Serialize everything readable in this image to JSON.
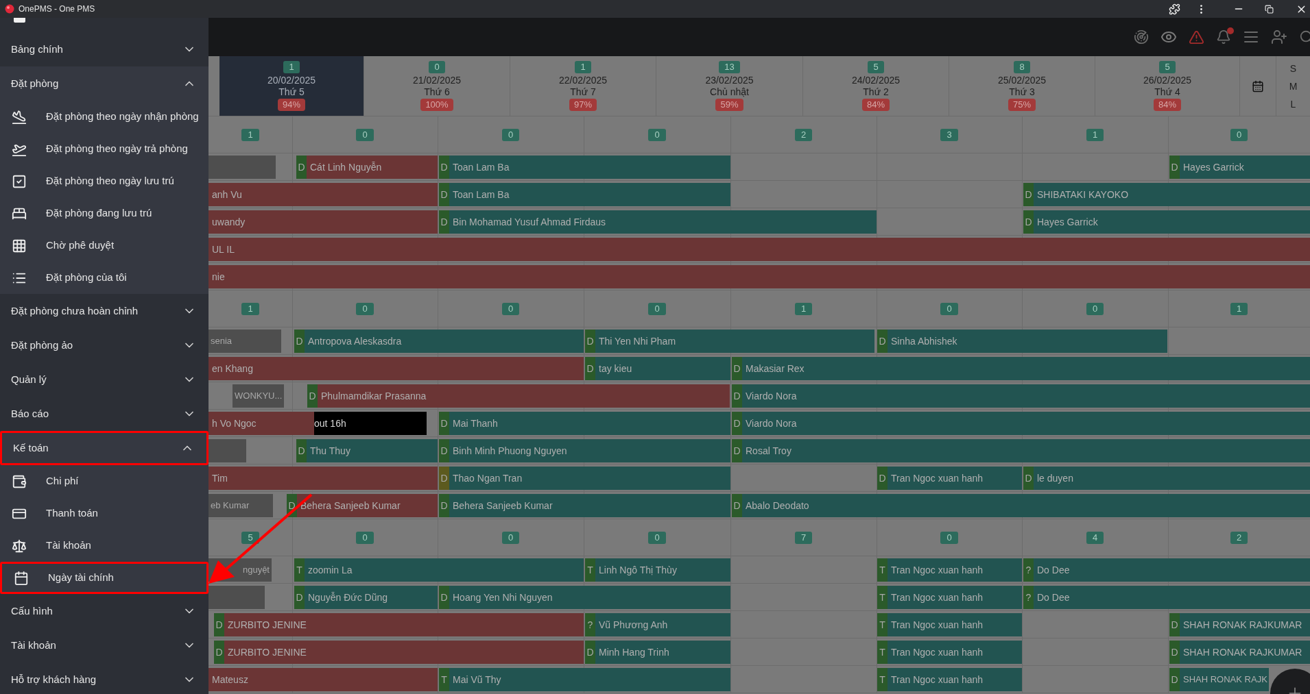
{
  "window": {
    "title": "OnePMS - One PMS"
  },
  "sidebar": {
    "sections": [
      {
        "label": "Bảng chính",
        "expanded": false,
        "highlighted": false
      },
      {
        "label": "Đặt phòng",
        "expanded": true,
        "highlighted": false,
        "children": [
          {
            "label": "Đặt phòng theo ngày nhận phòng",
            "highlighted": false
          },
          {
            "label": "Đặt phòng theo ngày trả phòng",
            "highlighted": false
          },
          {
            "label": "Đặt phòng theo ngày lưu trú",
            "highlighted": false
          },
          {
            "label": "Đặt phòng đang lưu trú",
            "highlighted": false
          },
          {
            "label": "Chờ phê duyệt",
            "highlighted": false
          },
          {
            "label": "Đặt phòng của tôi",
            "highlighted": false
          }
        ]
      },
      {
        "label": "Đặt phòng chưa hoàn chỉnh",
        "expanded": false,
        "highlighted": false
      },
      {
        "label": "Đặt phòng ảo",
        "expanded": false,
        "highlighted": false
      },
      {
        "label": "Quản lý",
        "expanded": false,
        "highlighted": false
      },
      {
        "label": "Báo cáo",
        "expanded": false,
        "highlighted": false
      },
      {
        "label": "Kế toán",
        "expanded": true,
        "highlighted": true,
        "children": [
          {
            "label": "Chi phí",
            "highlighted": false
          },
          {
            "label": "Thanh toán",
            "highlighted": false
          },
          {
            "label": "Tài khoản",
            "highlighted": false
          },
          {
            "label": "Ngày tài chính",
            "highlighted": true
          }
        ]
      },
      {
        "label": "Cấu hình",
        "expanded": false,
        "highlighted": false
      },
      {
        "label": "Tài khoản",
        "expanded": false,
        "highlighted": false
      },
      {
        "label": "Hỗ trợ khách hàng",
        "expanded": false,
        "highlighted": false
      }
    ]
  },
  "calendar": {
    "days": [
      {
        "count": "1",
        "date": "20/02/2025",
        "weekday": "Thứ 5",
        "occupancy": "94%",
        "selected": true
      },
      {
        "count": "0",
        "date": "21/02/2025",
        "weekday": "Thứ 6",
        "occupancy": "100%",
        "selected": false
      },
      {
        "count": "1",
        "date": "22/02/2025",
        "weekday": "Thứ 7",
        "occupancy": "97%",
        "selected": false
      },
      {
        "count": "13",
        "date": "23/02/2025",
        "weekday": "Chủ nhật",
        "occupancy": "59%",
        "selected": false
      },
      {
        "count": "5",
        "date": "24/02/2025",
        "weekday": "Thứ 2",
        "occupancy": "84%",
        "selected": false
      },
      {
        "count": "8",
        "date": "25/02/2025",
        "weekday": "Thứ 3",
        "occupancy": "75%",
        "selected": false
      },
      {
        "count": "5",
        "date": "26/02/2025",
        "weekday": "Thứ 4",
        "occupancy": "84%",
        "selected": false
      }
    ],
    "sizes": [
      "S",
      "M",
      "L"
    ],
    "groups": [
      {
        "counts": [
          "1",
          "0",
          "0",
          "0",
          "2",
          "3",
          "1",
          "0"
        ],
        "rows": [
          {
            "bars": [
              {
                "kind": "block"
              },
              {
                "kind": "booking",
                "tag": {
                  "label": "D",
                  "color": "#2b5a2a"
                },
                "name": "Cát Linh Nguyễn",
                "color": "#6b3535"
              },
              {
                "kind": "booking",
                "tag": {
                  "label": "D",
                  "color": "#2b5a2a"
                },
                "name": "Toan Lam Ba",
                "color": "#225451"
              },
              {
                "kind": "booking",
                "tag": {
                  "label": "D",
                  "color": "#2b5a2a"
                },
                "name": "Hayes Garrick",
                "color": "#225451"
              }
            ]
          },
          {
            "bars": [
              {
                "kind": "booking",
                "name": "anh Vu",
                "color": "#6b3535"
              },
              {
                "kind": "booking",
                "tag": {
                  "label": "D",
                  "color": "#2b5a2a"
                },
                "name": "Toan Lam Ba",
                "color": "#225451"
              },
              {
                "kind": "booking",
                "tag": {
                  "label": "D",
                  "color": "#2b5a2a"
                },
                "name": "SHIBATAKI KAYOKO",
                "color": "#225451"
              }
            ]
          },
          {
            "bars": [
              {
                "kind": "booking",
                "name": "uwandy",
                "color": "#6b3535"
              },
              {
                "kind": "booking",
                "tag": {
                  "label": "D",
                  "color": "#2b5a2a"
                },
                "name": "Bin Mohamad Yusuf Ahmad Firdaus",
                "color": "#225451"
              },
              {
                "kind": "booking",
                "tag": {
                  "label": "D",
                  "color": "#2b5a2a"
                },
                "name": "Hayes Garrick",
                "color": "#225451"
              }
            ]
          },
          {
            "bars": [
              {
                "kind": "booking",
                "name": "UL IL",
                "color": "#6b3535"
              }
            ]
          },
          {
            "bars": [
              {
                "kind": "booking",
                "name": "nie",
                "color": "#6b3535"
              }
            ]
          }
        ]
      },
      {
        "counts": [
          "1",
          "0",
          "0",
          "0",
          "1",
          "0",
          "0",
          "1"
        ],
        "rows": [
          {
            "bars": [
              {
                "kind": "block",
                "name": "senia"
              },
              {
                "kind": "booking",
                "tag": {
                  "label": "D",
                  "color": "#2b5a2a"
                },
                "name": "Antropova Aleskasdra",
                "color": "#225451"
              },
              {
                "kind": "booking",
                "tag": {
                  "label": "D",
                  "color": "#2b5a2a"
                },
                "name": "Thi Yen Nhi Pham",
                "color": "#225451"
              },
              {
                "kind": "booking",
                "tag": {
                  "label": "D",
                  "color": "#2b5a2a"
                },
                "name": "Sinha Abhishek",
                "color": "#225451"
              }
            ]
          },
          {
            "bars": [
              {
                "kind": "booking",
                "name": "en Khang",
                "color": "#6b3535"
              },
              {
                "kind": "booking",
                "tag": {
                  "label": "D",
                  "color": "#2b5a2a"
                },
                "name": "tay kieu",
                "color": "#225451"
              },
              {
                "kind": "booking",
                "tag": {
                  "label": "D",
                  "color": "#2b5a2a"
                },
                "name": "Makasiar Rex",
                "color": "#225451"
              }
            ]
          },
          {
            "bars": [
              {
                "kind": "block",
                "name": "WONKYU..."
              },
              {
                "kind": "booking",
                "tag": {
                  "label": "D",
                  "color": "#2b5a2a"
                },
                "name": "Phulmamdikar Prasanna",
                "color": "#6b3535"
              },
              {
                "kind": "booking",
                "tag": {
                  "label": "D",
                  "color": "#2b5a2a"
                },
                "name": "Viardo Nora",
                "color": "#225451"
              }
            ]
          },
          {
            "bars": [
              {
                "kind": "booking",
                "name": "h Vo Ngoc",
                "color": "#6b3535"
              },
              {
                "kind": "note",
                "name": "out 16h"
              },
              {
                "kind": "booking",
                "tag": {
                  "label": "D",
                  "color": "#2b5a2a"
                },
                "name": "Mai Thanh",
                "color": "#225451"
              },
              {
                "kind": "booking",
                "tag": {
                  "label": "D",
                  "color": "#2b5a2a"
                },
                "name": "Viardo Nora",
                "color": "#225451"
              }
            ]
          },
          {
            "bars": [
              {
                "kind": "block"
              },
              {
                "kind": "booking",
                "tag": {
                  "label": "D",
                  "color": "#2b5a2a"
                },
                "name": "Thu Thuy",
                "color": "#225451"
              },
              {
                "kind": "booking",
                "tag": {
                  "label": "D",
                  "color": "#2b5a2a"
                },
                "name": "Binh Minh Phuong Nguyen",
                "color": "#225451"
              },
              {
                "kind": "booking",
                "tag": {
                  "label": "D",
                  "color": "#2b5a2a"
                },
                "name": "Rosal Troy",
                "color": "#225451"
              }
            ]
          },
          {
            "bars": [
              {
                "kind": "booking",
                "name": "Tim",
                "color": "#6b3535"
              },
              {
                "kind": "booking",
                "tag": {
                  "label": "D",
                  "color": "#5c5a1e"
                },
                "name": "Thao Ngan Tran",
                "color": "#225451"
              },
              {
                "kind": "booking",
                "tag": {
                  "label": "D",
                  "color": "#2b5a2a"
                },
                "name": "Tran Ngoc xuan hanh",
                "color": "#225451"
              },
              {
                "kind": "booking",
                "tag": {
                  "label": "D",
                  "color": "#2b5a2a"
                },
                "name": "le duyen",
                "color": "#225451"
              }
            ]
          },
          {
            "bars": [
              {
                "kind": "block",
                "name": "eb Kumar"
              },
              {
                "kind": "booking",
                "tag": {
                  "label": "D",
                  "color": "#2b5a2a"
                },
                "name": "Behera Sanjeeb Kumar",
                "color": "#6b3535"
              },
              {
                "kind": "booking",
                "tag": {
                  "label": "D",
                  "color": "#2b5a2a"
                },
                "name": "Behera Sanjeeb Kumar",
                "color": "#225451"
              },
              {
                "kind": "booking",
                "tag": {
                  "label": "D",
                  "color": "#2b5a2a"
                },
                "name": "Abalo Deodato",
                "color": "#225451"
              }
            ]
          }
        ]
      },
      {
        "counts": [
          "5",
          "0",
          "0",
          "0",
          "7",
          "0",
          "4",
          "2"
        ],
        "rows": [
          {
            "bars": [
              {
                "kind": "block",
                "name": "nguyệt"
              },
              {
                "kind": "booking",
                "tag": {
                  "label": "T",
                  "color": "#2b5a2a"
                },
                "name": "zoomin La",
                "color": "#225451"
              },
              {
                "kind": "booking",
                "tag": {
                  "label": "T",
                  "color": "#2b5a2a"
                },
                "name": "Linh Ngô Thị Thùy",
                "color": "#225451"
              },
              {
                "kind": "booking",
                "tag": {
                  "label": "T",
                  "color": "#2b5a2a"
                },
                "name": "Tran Ngoc xuan hanh",
                "color": "#225451"
              },
              {
                "kind": "booking",
                "tag": {
                  "label": "?",
                  "color": "#2b5a2a"
                },
                "name": "Do Dee",
                "color": "#225451"
              }
            ]
          },
          {
            "bars": [
              {
                "kind": "block"
              },
              {
                "kind": "booking",
                "tag": {
                  "label": "D",
                  "color": "#2b5a2a"
                },
                "name": "Nguyễn Đức Dũng",
                "color": "#225451"
              },
              {
                "kind": "booking",
                "tag": {
                  "label": "D",
                  "color": "#2b5a2a"
                },
                "name": "Hoang Yen Nhi Nguyen",
                "color": "#225451"
              },
              {
                "kind": "booking",
                "tag": {
                  "label": "T",
                  "color": "#2b5a2a"
                },
                "name": "Tran Ngoc xuan hanh",
                "color": "#225451"
              },
              {
                "kind": "booking",
                "tag": {
                  "label": "?",
                  "color": "#2b5a2a"
                },
                "name": "Do Dee",
                "color": "#225451"
              }
            ]
          },
          {
            "bars": [
              {
                "kind": "booking",
                "tag": {
                  "label": "D",
                  "color": "#2b5a2a"
                },
                "name": "ZURBITO JENINE",
                "color": "#6b3535"
              },
              {
                "kind": "booking",
                "tag": {
                  "label": "?",
                  "color": "#2b5a2a"
                },
                "name": "Vũ Phương Anh",
                "color": "#225451"
              },
              {
                "kind": "booking",
                "tag": {
                  "label": "T",
                  "color": "#2b5a2a"
                },
                "name": "Tran Ngoc xuan hanh",
                "color": "#225451"
              },
              {
                "kind": "booking",
                "tag": {
                  "label": "D",
                  "color": "#2b5a2a"
                },
                "name": "SHAH RONAK RAJKUMAR",
                "color": "#225451"
              }
            ]
          },
          {
            "bars": [
              {
                "kind": "booking",
                "tag": {
                  "label": "D",
                  "color": "#2b5a2a"
                },
                "name": "ZURBITO JENINE",
                "color": "#6b3535"
              },
              {
                "kind": "booking",
                "tag": {
                  "label": "D",
                  "color": "#2b5a2a"
                },
                "name": "Minh Hang Trinh",
                "color": "#225451"
              },
              {
                "kind": "booking",
                "tag": {
                  "label": "T",
                  "color": "#2b5a2a"
                },
                "name": "Tran Ngoc xuan hanh",
                "color": "#225451"
              },
              {
                "kind": "booking",
                "tag": {
                  "label": "D",
                  "color": "#2b5a2a"
                },
                "name": "SHAH RONAK RAJKUMAR",
                "color": "#225451"
              }
            ]
          },
          {
            "bars": [
              {
                "kind": "booking",
                "name": "Mateusz",
                "color": "#6b3535"
              },
              {
                "kind": "booking",
                "tag": {
                  "label": "T",
                  "color": "#2b5a2a"
                },
                "name": "Mai Vũ Thy",
                "color": "#225451"
              },
              {
                "kind": "booking",
                "tag": {
                  "label": "T",
                  "color": "#2b5a2a"
                },
                "name": "Tran Ngoc xuan hanh",
                "color": "#225451"
              },
              {
                "kind": "booking",
                "tag": {
                  "label": "D",
                  "color": "#2b5a2a"
                },
                "name": "SHAH RONAK RAJK",
                "color": "#225451"
              }
            ]
          }
        ]
      }
    ]
  }
}
